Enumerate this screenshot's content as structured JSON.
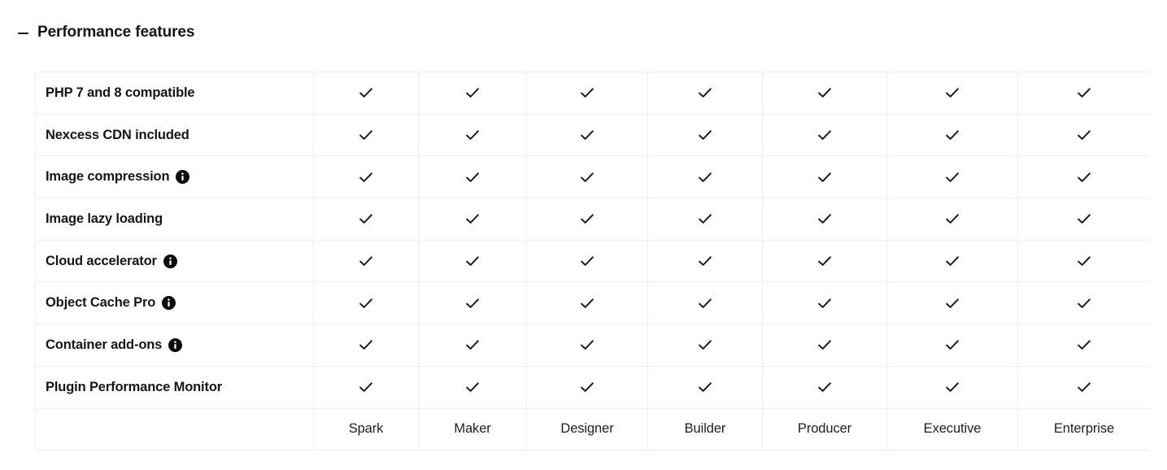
{
  "section": {
    "title": "Performance features",
    "collapse_icon": "minus-icon",
    "expanded": true
  },
  "table": {
    "feature_column_header": "",
    "plans": [
      "Spark",
      "Maker",
      "Designer",
      "Builder",
      "Producer",
      "Executive",
      "Enterprise"
    ],
    "check_icon": "checkmark-icon",
    "info_icon": "info-icon",
    "rows": [
      {
        "feature": "PHP 7 and 8 compatible",
        "has_info": false,
        "values": [
          "check",
          "check",
          "check",
          "check",
          "check",
          "check",
          "check"
        ]
      },
      {
        "feature": "Nexcess CDN included",
        "has_info": false,
        "values": [
          "check",
          "check",
          "check",
          "check",
          "check",
          "check",
          "check"
        ]
      },
      {
        "feature": "Image compression",
        "has_info": true,
        "values": [
          "check",
          "check",
          "check",
          "check",
          "check",
          "check",
          "check"
        ]
      },
      {
        "feature": "Image lazy loading",
        "has_info": false,
        "values": [
          "check",
          "check",
          "check",
          "check",
          "check",
          "check",
          "check"
        ]
      },
      {
        "feature": "Cloud accelerator",
        "has_info": true,
        "values": [
          "check",
          "check",
          "check",
          "check",
          "check",
          "check",
          "check"
        ]
      },
      {
        "feature": "Object Cache Pro",
        "has_info": true,
        "values": [
          "check",
          "check",
          "check",
          "check",
          "check",
          "check",
          "check"
        ]
      },
      {
        "feature": "Container add-ons",
        "has_info": true,
        "values": [
          "check",
          "check",
          "check",
          "check",
          "check",
          "check",
          "check"
        ]
      },
      {
        "feature": "Plugin Performance Monitor",
        "has_info": false,
        "values": [
          "check",
          "check",
          "check",
          "check",
          "check",
          "check",
          "check"
        ]
      }
    ]
  },
  "colors": {
    "text": "#15161a",
    "border": "#eceef3",
    "outer_border": "#e9eaf0",
    "background": "#ffffff",
    "info_badge": "#0b0c0f"
  }
}
